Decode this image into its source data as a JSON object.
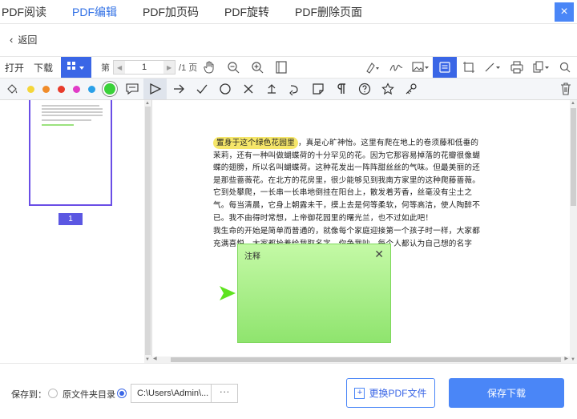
{
  "tabs": [
    {
      "label": "PDF阅读",
      "active": false
    },
    {
      "label": "PDF编辑",
      "active": true
    },
    {
      "label": "PDF加页码",
      "active": false
    },
    {
      "label": "PDF旋转",
      "active": false
    },
    {
      "label": "PDF删除页面",
      "active": false
    }
  ],
  "close_icon": "×",
  "back": {
    "label": "返回"
  },
  "toolbar": {
    "open": "打开",
    "download": "下载",
    "page_prefix": "第",
    "page_current": "1",
    "page_total": "/1 页"
  },
  "annot_colors": [
    "#f4d63a",
    "#f08c2a",
    "#e83b2b",
    "#e13cc7",
    "#2aa0e8",
    "#3ad13a"
  ],
  "sidebar": {
    "page_badge": "1"
  },
  "document": {
    "highlighted": "置身于这个绿色花园里",
    "para1_rest": "，真是心旷神怡。这里有爬在地上的卷须藤和低垂的茉莉，还有一种叫做蝴蝶荷的十分罕见的花。因为它那容易掉落的花瓣很像蝴蝶的翅膀，所以名叫蝴蝶荷。这种花发出一阵阵甜丝丝的气味。但最美丽的还是那些蔷薇花。在北方的花房里，很少能够见到我南方家里的这种爬藤蔷薇。它到处攀爬，一长串一长串地倒挂在阳台上，散发着芳香，丝毫没有尘土之气。每当清晨，它身上朝露未干，摸上去是何等柔软，何等高洁，使人陶醉不已。我不由得时常想，上帝御花园里的曙光兰，也不过如此吧！",
    "para2": "我生命的开始是简单而普通的，就像每个家庭迎接第一个孩子时一样，大家都充满喜悦。大家都抢着给我取名字，你争我吵，每个人都认为自己想的名字"
  },
  "note": {
    "title": "注释"
  },
  "bottom": {
    "save_to": "保存到：",
    "original_dir": "原文件夹目录",
    "path": "C:\\Users\\Admin\\...",
    "more": "···",
    "swap": "更换PDF文件",
    "save_download": "保存下载"
  }
}
